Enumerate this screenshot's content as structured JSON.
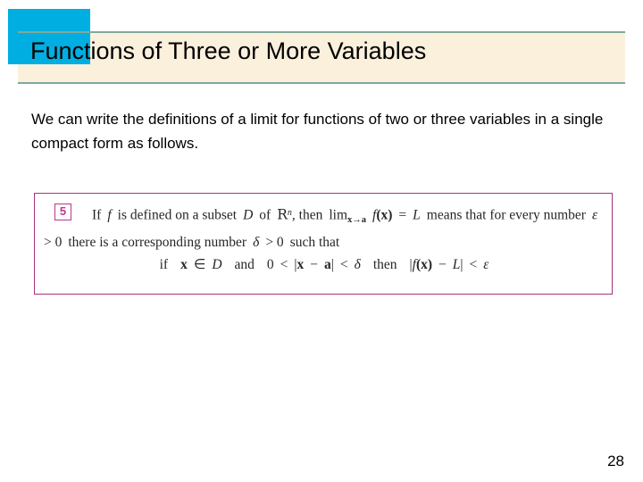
{
  "slide": {
    "title": "Functions of Three or More Variables",
    "page_number": "28",
    "accent_color": "#00aee2",
    "banner_color": "#faf0dc",
    "banner_rule_color": "#7fa99b",
    "definition_border_color": "#a4337e",
    "definition_number_color": "#c0358e"
  },
  "body": {
    "paragraph": "We can write the definitions of a limit for functions of two or three variables in a single compact form as follows."
  },
  "definition": {
    "number": "5",
    "line1_a": "If",
    "line1_f": "f",
    "line1_b": "is defined on a subset",
    "line1_D": "D",
    "line1_c": "of",
    "line1_R": "R",
    "line1_n": "n",
    "line1_d": ", then",
    "line1_lim": "lim",
    "line1_limsub": "x→a",
    "line1_fx": "f",
    "line1_x": "(x)",
    "line1_eq": "=",
    "line1_L": "L",
    "line1_e": "means that for every number",
    "line1_eps": "ε",
    "line1_gt0": "> 0",
    "line1_f2": "there is a corresponding number",
    "line1_delta": "δ",
    "line1_gt0b": "> 0",
    "line1_g": "such that",
    "display_if": "if",
    "display_x": "x",
    "display_in": "∈",
    "display_D": "D",
    "display_and": "and",
    "display_zero": "0",
    "display_lt1": "<",
    "display_absopen": "|",
    "display_x2": "x",
    "display_minus": "−",
    "display_a": "a",
    "display_absclose": "|",
    "display_lt2": "<",
    "display_delta": "δ",
    "display_then": "then",
    "display_abs2open": "|",
    "display_f": "f",
    "display_fx": "(x)",
    "display_minus2": "−",
    "display_L": "L",
    "display_abs2close": "|",
    "display_lt3": "<",
    "display_eps": "ε",
    "plain_text": "If f is defined on a subset D of R^n, then lim(x→a) f(x) = L means that for every number ε > 0 there is a corresponding number δ > 0 such that  if x ∈ D and 0 < |x − a| < δ then |f(x) − L| < ε"
  }
}
